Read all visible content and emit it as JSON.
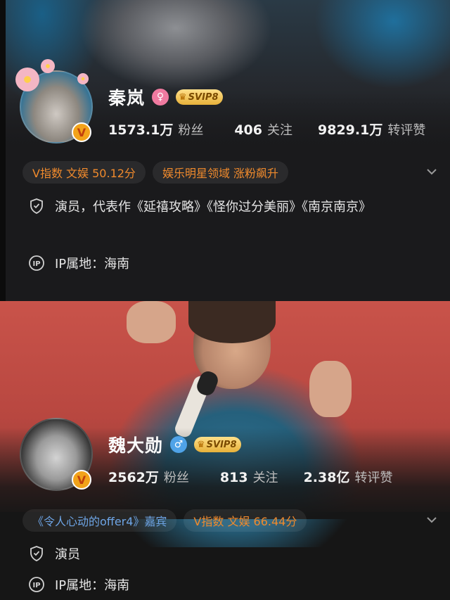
{
  "profiles": [
    {
      "name": "秦岚",
      "gender": "♀",
      "vip": "SVIP8",
      "stats": {
        "fans_num": "1573.1万",
        "fans_label": "粉丝",
        "follow_num": "406",
        "follow_label": "关注",
        "likes_num": "9829.1万",
        "likes_label": "转评赞"
      },
      "tags": [
        "V指数 文娱 50.12分",
        "娱乐明星领域 涨粉飙升"
      ],
      "bio": "演员，代表作《延禧攻略》《怪你过分美丽》《南京南京》",
      "ip": "IP属地：海南"
    },
    {
      "name": "魏大勋",
      "gender": "♂",
      "vip": "SVIP8",
      "stats": {
        "fans_num": "2562万",
        "fans_label": "粉丝",
        "follow_num": "813",
        "follow_label": "关注",
        "likes_num": "2.38亿",
        "likes_label": "转评赞"
      },
      "tags": [
        "《令人心动的offer4》嘉宾",
        "V指数 文娱 66.44分"
      ],
      "bio": "演员",
      "ip": "IP属地：海南"
    }
  ],
  "verified_badge": "V",
  "colors": {
    "tag_orange": "#f08a2c",
    "tag_blue": "#6ea5e6",
    "vip_gold": "#e7b13a",
    "badge": "#f2a31a"
  },
  "icons": [
    "search-gender-female-icon",
    "gender-male-icon",
    "crown-icon",
    "shield-icon",
    "ip-icon",
    "chevron-down-icon",
    "verified-v-icon"
  ]
}
